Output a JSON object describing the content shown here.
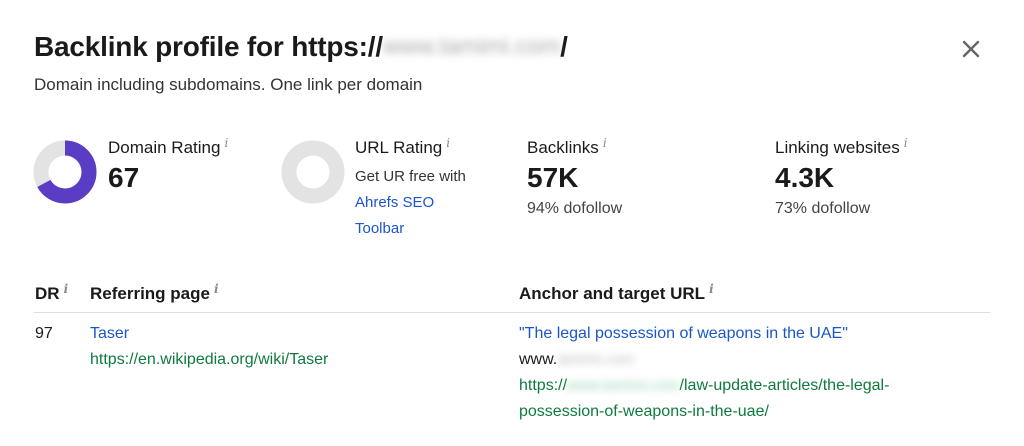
{
  "header": {
    "title_prefix": "Backlink profile for https://",
    "title_domain_blurred": "www.tamimi.com",
    "title_suffix": "/",
    "subtitle": "Domain including subdomains. One link per domain"
  },
  "metrics": {
    "domain_rating": {
      "label": "Domain Rating",
      "value": "67",
      "ring_fill": 0.67,
      "ring_color": "#5b3cc4"
    },
    "url_rating": {
      "label": "URL Rating",
      "line1": "Get UR free with",
      "link1": "Ahrefs SEO",
      "link2": "Toolbar"
    },
    "backlinks": {
      "label": "Backlinks",
      "value": "57K",
      "sub": "94% dofollow"
    },
    "linking_websites": {
      "label": "Linking websites",
      "value": "4.3K",
      "sub": "73% dofollow"
    }
  },
  "table": {
    "headers": {
      "dr": "DR",
      "referring_page": "Referring page",
      "anchor_target": "Anchor and target URL"
    },
    "rows": [
      {
        "dr": "97",
        "page_title": "Taser",
        "page_url": "https://en.wikipedia.org/wiki/Taser",
        "anchor": "\"The legal possession of weapons in the UAE\"",
        "target_prefix": "www.",
        "target_domain_blurred": "tamimi.com",
        "url_prefix": "https://",
        "url_domain_blurred": "www.tamimi.com",
        "url_path_line1": "/law-update-articles/the-legal-",
        "url_path_line2": "possession-of-weapons-in-the-uae/"
      }
    ]
  },
  "colors": {
    "link_blue": "#1a56c9",
    "url_green": "#0f7a3e",
    "dr_ring": "#5b3cc4",
    "ring_bg": "#e3e3e3"
  },
  "icons": {
    "close": "close-icon",
    "info": "info-icon"
  }
}
